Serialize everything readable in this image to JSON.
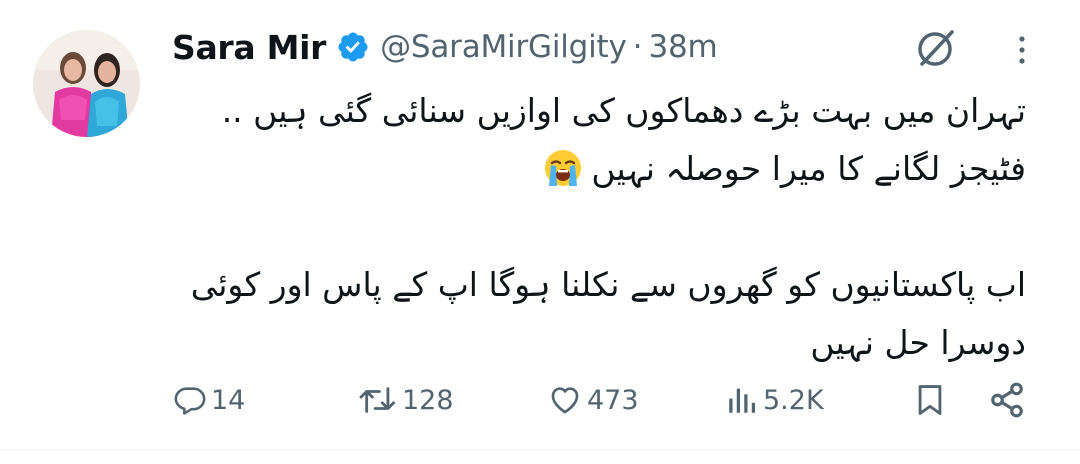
{
  "tweet": {
    "author_name": "Sara Mir",
    "handle": "@SaraMirGilgity",
    "separator": "·",
    "time": "38m",
    "text_lines": [
      "تہران میں بہت بڑے دھماکوں کی اوازیں سنائی گئی ہیں ..",
      "فٹیجز لگانے کا میرا حوصلہ نہیں",
      "اب پاکستانیوں کو گھروں سے نکلنا ہوگا اپ کے پاس اور کوئی",
      "دوسرا حل نہیں"
    ],
    "emoji": "loudly-crying-face"
  },
  "actions": {
    "replies": "14",
    "reposts": "128",
    "likes": "473",
    "views": "5.2K"
  },
  "icons": {
    "verified": "verified-badge-icon",
    "grok": "grok-icon",
    "more": "more-icon",
    "reply": "reply-icon",
    "repost": "repost-icon",
    "like": "heart-icon",
    "views": "views-icon",
    "bookmark": "bookmark-icon",
    "share": "share-icon"
  },
  "colors": {
    "text": "#0f1419",
    "secondary": "#536471",
    "verified": "#1d9bf0",
    "divider": "#eff3f4"
  }
}
